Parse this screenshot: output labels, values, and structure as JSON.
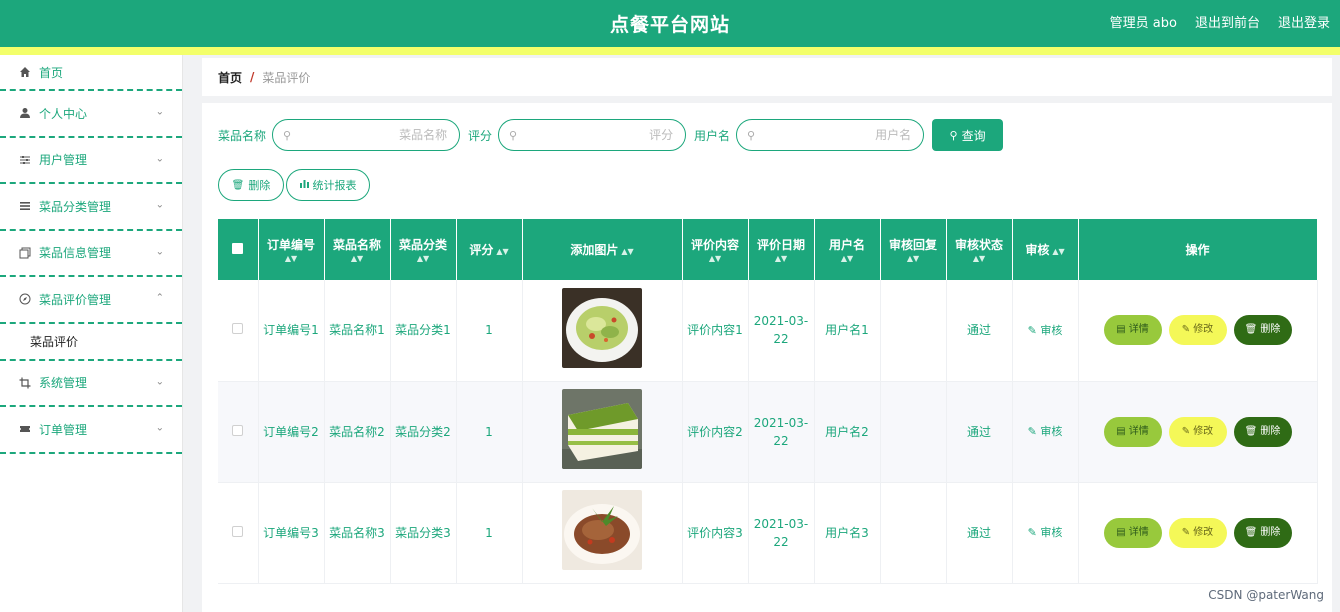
{
  "header": {
    "site_title": "点餐平台网站",
    "admin_label": "管理员 abo",
    "back_front": "退出到前台",
    "logout": "退出登录"
  },
  "sidebar": {
    "items": [
      {
        "label": "首页",
        "icon": "home-icon"
      },
      {
        "label": "个人中心",
        "icon": "user-icon"
      },
      {
        "label": "用户管理",
        "icon": "sliders-icon"
      },
      {
        "label": "菜品分类管理",
        "icon": "list-icon"
      },
      {
        "label": "菜品信息管理",
        "icon": "copy-icon"
      },
      {
        "label": "菜品评价管理",
        "icon": "compass-icon"
      },
      {
        "label": "系统管理",
        "icon": "crop-icon"
      },
      {
        "label": "订单管理",
        "icon": "ticket-icon"
      }
    ],
    "submenu": "菜品评价"
  },
  "breadcrumb": {
    "home": "首页",
    "separator": "/",
    "current": "菜品评价"
  },
  "search": {
    "dish_label": "菜品名称",
    "dish_placeholder": "菜品名称",
    "score_label": "评分",
    "score_placeholder": "评分",
    "user_label": "用户名",
    "user_placeholder": "用户名",
    "query_button": "查询"
  },
  "actions": {
    "delete": "删除",
    "stats": "统计报表"
  },
  "table": {
    "headers": [
      "订单编号",
      "菜品名称",
      "菜品分类",
      "评分",
      "添加图片",
      "评价内容",
      "评价日期",
      "用户名",
      "审核回复",
      "审核状态",
      "审核",
      "操作"
    ],
    "rows": [
      {
        "order": "订单编号1",
        "dish": "菜品名称1",
        "category": "菜品分类1",
        "score": "1",
        "content": "评价内容1",
        "date": "2021-03-22",
        "user": "用户名1",
        "reply": "",
        "status": "通过",
        "audit": "审核"
      },
      {
        "order": "订单编号2",
        "dish": "菜品名称2",
        "category": "菜品分类2",
        "score": "1",
        "content": "评价内容2",
        "date": "2021-03-22",
        "user": "用户名2",
        "reply": "",
        "status": "通过",
        "audit": "审核"
      },
      {
        "order": "订单编号3",
        "dish": "菜品名称3",
        "category": "菜品分类3",
        "score": "1",
        "content": "评价内容3",
        "date": "2021-03-22",
        "user": "用户名3",
        "reply": "",
        "status": "通过",
        "audit": "审核"
      }
    ],
    "op_detail": "详情",
    "op_edit": "修改",
    "op_delete": "删除"
  },
  "watermark": "CSDN @paterWang",
  "colors": {
    "primary": "#1ca77c",
    "accent_yellow": "#f3ff6a",
    "detail_btn": "#98c93c",
    "edit_btn": "#f4f858",
    "delete_btn": "#2f6b15"
  }
}
